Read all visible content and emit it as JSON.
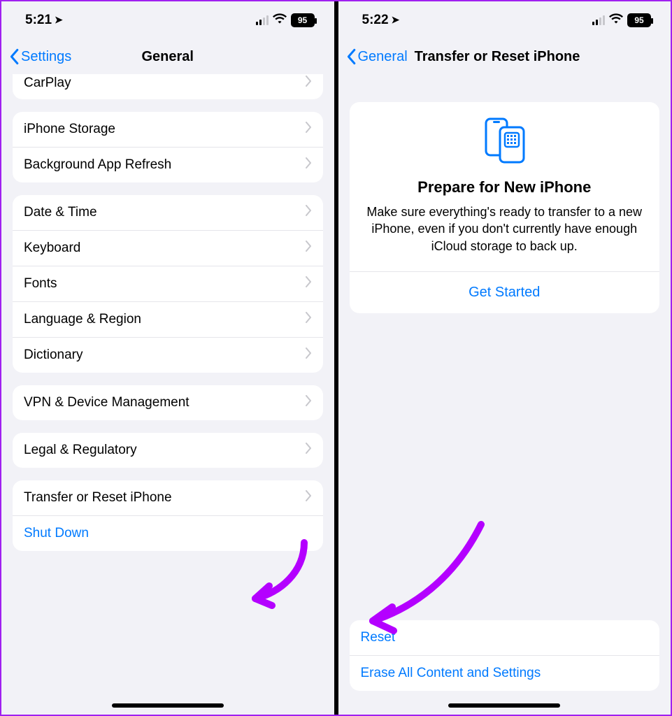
{
  "left": {
    "status": {
      "time": "5:21",
      "battery": "95"
    },
    "nav": {
      "back": "Settings",
      "title": "General"
    },
    "rows": {
      "carplay": "CarPlay",
      "storage": "iPhone Storage",
      "bgrefresh": "Background App Refresh",
      "datetime": "Date & Time",
      "keyboard": "Keyboard",
      "fonts": "Fonts",
      "langregion": "Language & Region",
      "dictionary": "Dictionary",
      "vpn": "VPN & Device Management",
      "legal": "Legal & Regulatory",
      "transfer": "Transfer or Reset iPhone",
      "shutdown": "Shut Down"
    }
  },
  "right": {
    "status": {
      "time": "5:22",
      "battery": "95"
    },
    "nav": {
      "back": "General",
      "title": "Transfer or Reset iPhone"
    },
    "card": {
      "title": "Prepare for New iPhone",
      "body": "Make sure everything's ready to transfer to a new iPhone, even if you don't currently have enough iCloud storage to back up.",
      "cta": "Get Started"
    },
    "actions": {
      "reset": "Reset",
      "erase": "Erase All Content and Settings"
    }
  }
}
